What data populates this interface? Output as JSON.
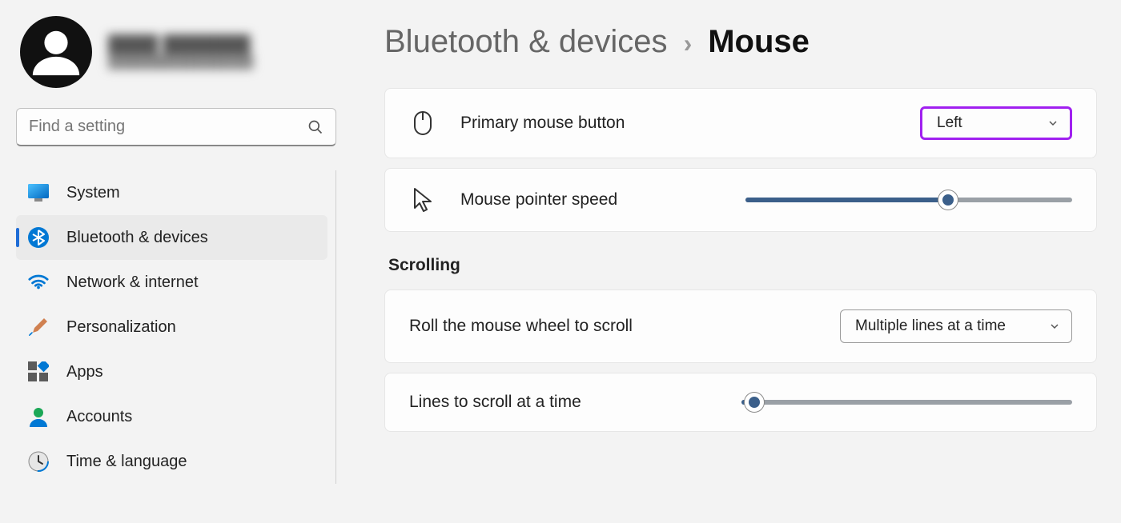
{
  "profile": {
    "name": "████ ███████",
    "sub": "████████████████"
  },
  "search": {
    "placeholder": "Find a setting"
  },
  "sidebar": {
    "items": [
      {
        "label": "System",
        "icon": "system"
      },
      {
        "label": "Bluetooth & devices",
        "icon": "bluetooth",
        "active": true
      },
      {
        "label": "Network & internet",
        "icon": "wifi"
      },
      {
        "label": "Personalization",
        "icon": "brush"
      },
      {
        "label": "Apps",
        "icon": "apps"
      },
      {
        "label": "Accounts",
        "icon": "person"
      },
      {
        "label": "Time & language",
        "icon": "clock"
      }
    ]
  },
  "breadcrumb": {
    "parent": "Bluetooth & devices",
    "current": "Mouse"
  },
  "settings": {
    "primary_button": {
      "label": "Primary mouse button",
      "value": "Left"
    },
    "pointer_speed": {
      "label": "Mouse pointer speed",
      "value_pct": 62
    },
    "scrolling_header": "Scrolling",
    "wheel_scroll": {
      "label": "Roll the mouse wheel to scroll",
      "value": "Multiple lines at a time"
    },
    "lines_scroll": {
      "label": "Lines to scroll at a time",
      "value_pct": 4
    }
  }
}
